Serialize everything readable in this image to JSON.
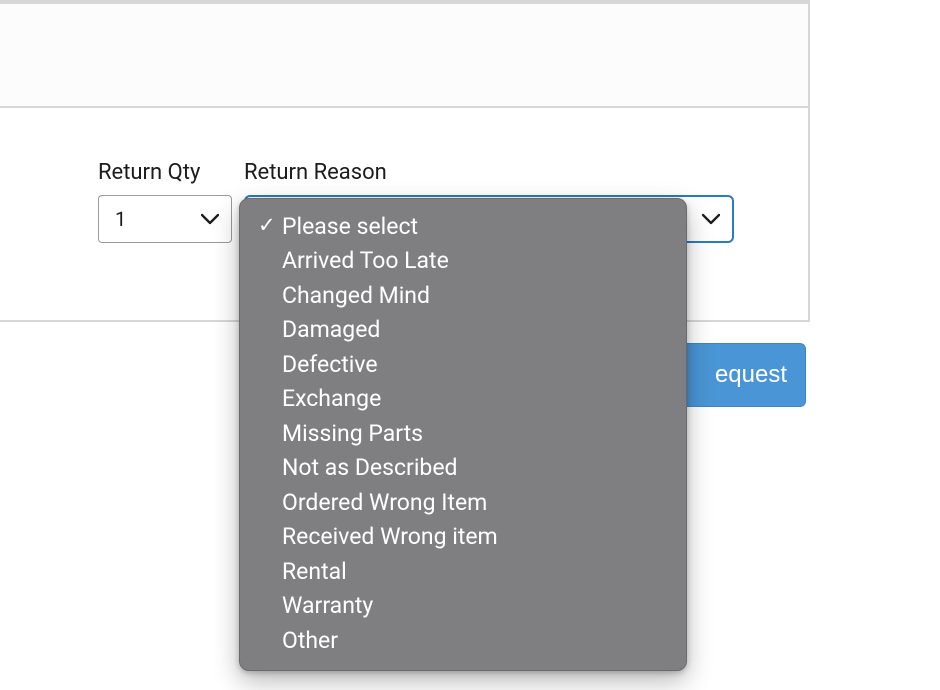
{
  "return_qty": {
    "label": "Return Qty",
    "value": "1"
  },
  "return_reason": {
    "label": "Return Reason",
    "selected": "Please select",
    "options": [
      "Please select",
      "Arrived Too Late",
      "Changed Mind",
      "Damaged",
      "Defective",
      "Exchange",
      "Missing Parts",
      "Not as Described",
      "Ordered Wrong Item",
      "Received Wrong item",
      "Rental",
      "Warranty",
      "Other"
    ]
  },
  "submit": {
    "label_visible": "equest"
  },
  "checkmark": "✓"
}
